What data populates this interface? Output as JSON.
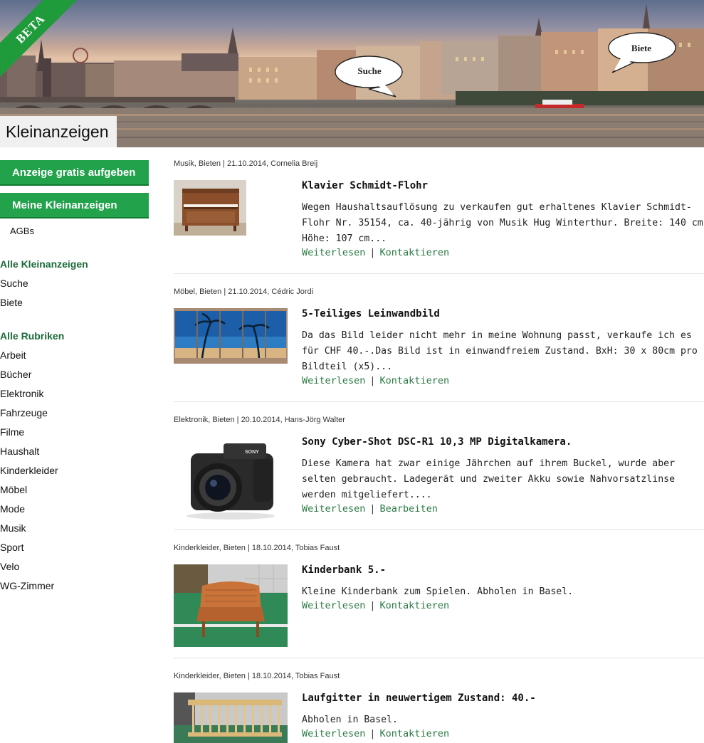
{
  "header": {
    "beta_label": "BETA",
    "bubble_search": "Suche",
    "bubble_offer": "Biete",
    "page_title": "Kleinanzeigen"
  },
  "sidebar": {
    "post_ad_button": "Anzeige gratis aufgeben",
    "my_ads_button": "Meine Kleinanzeigen",
    "agb_link": "AGBs",
    "all_ads_heading": "Alle Kleinanzeigen",
    "all_ads_links": [
      "Suche",
      "Biete"
    ],
    "categories_heading": "Alle Rubriken",
    "categories": [
      "Arbeit",
      "Bücher",
      "Elektronik",
      "Fahrzeuge",
      "Filme",
      "Haushalt",
      "Kinderkleider",
      "Möbel",
      "Mode",
      "Musik",
      "Sport",
      "Velo",
      "WG-Zimmer"
    ]
  },
  "listings": [
    {
      "meta": "Musik, Bieten | 21.10.2014, Cornelia Breij",
      "title": "Klavier Schmidt-Flohr",
      "description": "Wegen Haushaltsauflösung zu verkaufen gut erhaltenes Klavier Schmidt-Flohr Nr. 35154, ca. 40-jährig von Musik Hug Winterthur. Breite: 140 cm Höhe: 107 cm...",
      "read_more": "Weiterlesen",
      "action": "Kontaktieren",
      "thumb": "piano"
    },
    {
      "meta": "Möbel, Bieten | 21.10.2014, Cédric Jordi",
      "title": "5-Teiliges Leinwandbild",
      "description": "Da das Bild leider nicht mehr in meine Wohnung passt, verkaufe ich es für CHF 40.-.Das Bild ist in einwandfreiem Zustand. BxH: 30 x 80cm pro Bildteil (x5)...",
      "read_more": "Weiterlesen",
      "action": "Kontaktieren",
      "thumb": "canvas-palms"
    },
    {
      "meta": "Elektronik, Bieten | 20.10.2014, Hans-Jörg Walter",
      "title": "Sony Cyber-Shot DSC-R1 10,3 MP Digitalkamera.",
      "description": "Diese Kamera hat zwar einige Jährchen auf ihrem Buckel, wurde aber selten gebraucht. Ladegerät und zweiter Akku sowie Nahvorsatzlinse werden mitgeliefert....",
      "read_more": "Weiterlesen",
      "action": "Bearbeiten",
      "thumb": "camera",
      "camera_brand": "SONY"
    },
    {
      "meta": "Kinderkleider, Bieten | 18.10.2014, Tobias Faust",
      "title": "Kinderbank 5.-",
      "description": "Kleine Kinderbank zum Spielen. Abholen in Basel.",
      "read_more": "Weiterlesen",
      "action": "Kontaktieren",
      "thumb": "bench"
    },
    {
      "meta": "Kinderkleider, Bieten | 18.10.2014, Tobias Faust",
      "title": "Laufgitter in neuwertigem Zustand: 40.-",
      "description": "Abholen in Basel.",
      "read_more": "Weiterlesen",
      "action": "Kontaktieren",
      "thumb": "playpen"
    }
  ],
  "colors": {
    "accent_green": "#21a24b",
    "heading_green": "#1b6b38",
    "link_green": "#2a7a44",
    "beta_green": "#1f9b3c"
  }
}
